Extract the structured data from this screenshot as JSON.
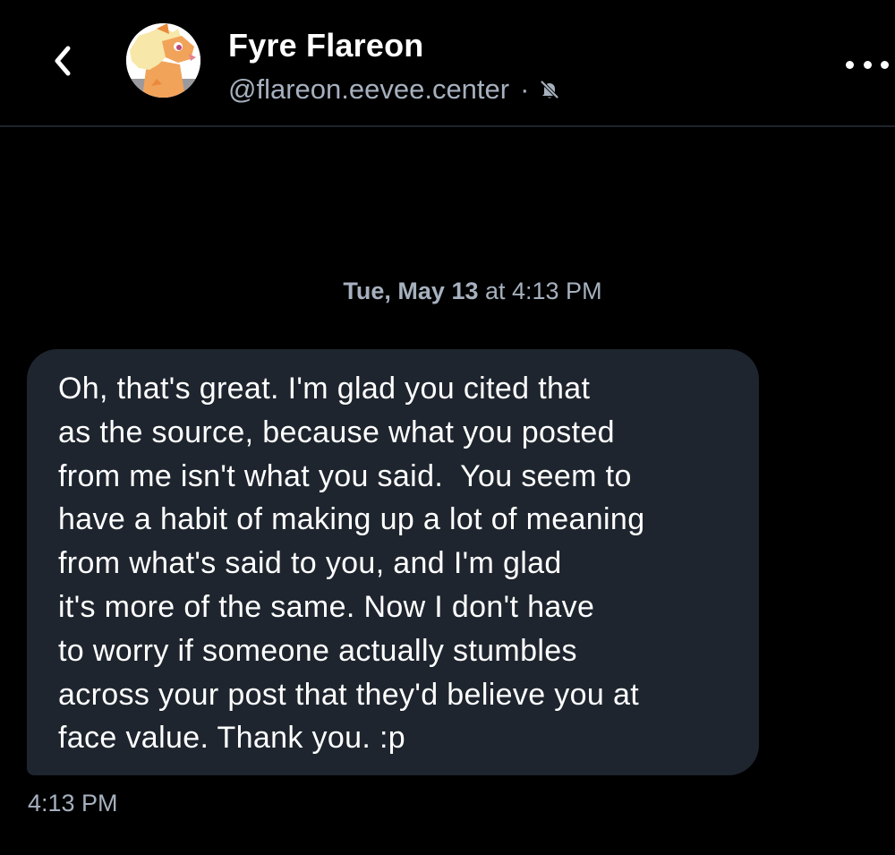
{
  "header": {
    "back_icon": "chevron-left-icon",
    "name": "Fyre Flareon",
    "handle": "@flareon.eevee.center",
    "separator": "·",
    "mute_icon": "bell-off-icon",
    "more_icon": "ellipsis-horizontal-icon"
  },
  "conversation": {
    "date_day": "Tue, May 13",
    "date_time": " at 4:13 PM",
    "message": {
      "text": "Oh, that's great. I'm glad you cited that\nas the source, because what you posted\nfrom me isn't what you said.  You seem to\nhave a habit of making up a lot of meaning\nfrom what's said to you, and I'm glad\nit's more of the same. Now I don't have\nto worry if someone actually stumbles\nacross your post that they'd believe you at\nface value. Thank you. :p",
      "time": "4:13 PM"
    }
  },
  "colors": {
    "background": "#000000",
    "bubble": "#1e252e",
    "secondary_text": "#a6b0be",
    "divider": "#1e242c",
    "avatar_fur": "#f2a35a",
    "avatar_mane": "#f7e7a9"
  }
}
